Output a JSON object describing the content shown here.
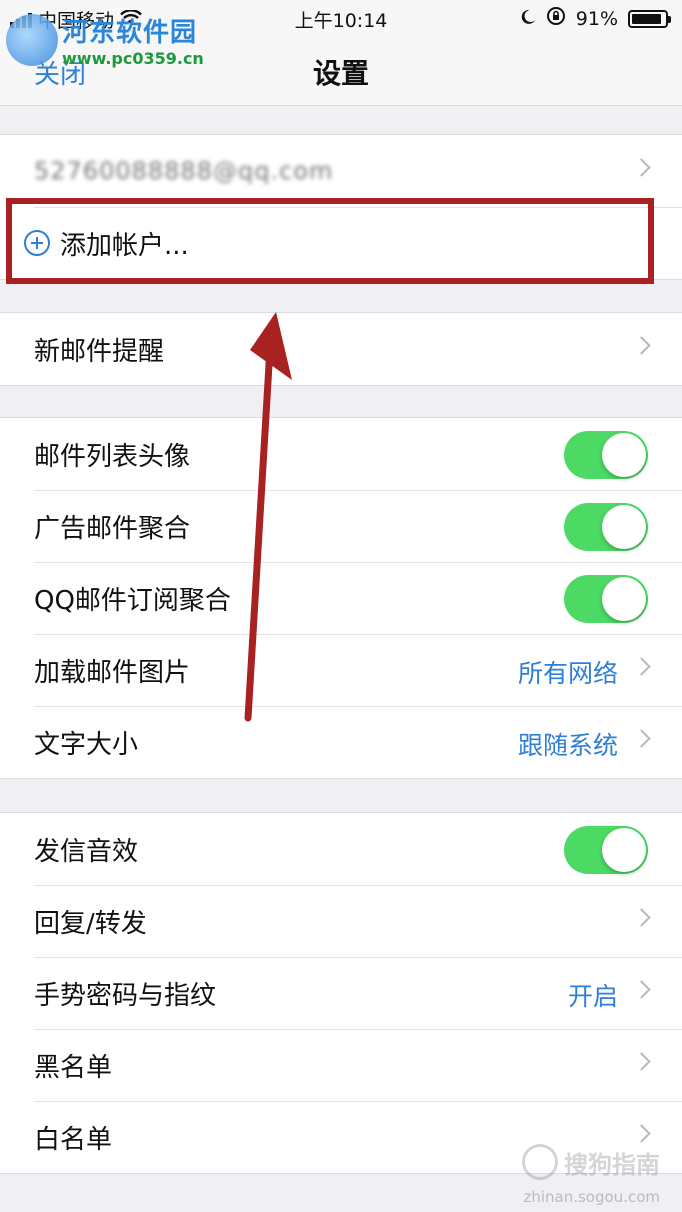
{
  "status_bar": {
    "carrier": "中国移动",
    "time": "上午10:14",
    "battery": "91%",
    "battery_level": 0.91
  },
  "watermark": {
    "title": "河东软件园",
    "url": "www.pc0359.cn"
  },
  "nav": {
    "close_label": "关闭",
    "title": "设置"
  },
  "account": {
    "email": "52760088888@qq.com",
    "add_label": "添加帐户..."
  },
  "notify": {
    "label": "新邮件提醒"
  },
  "display": {
    "avatar_label": "邮件列表头像",
    "ad_label": "广告邮件聚合",
    "qq_sub_label": "QQ邮件订阅聚合",
    "load_images_label": "加载邮件图片",
    "load_images_value": "所有网络",
    "font_size_label": "文字大小",
    "font_size_value": "跟随系统"
  },
  "misc": {
    "send_sound_label": "发信音效",
    "reply_label": "回复/转发",
    "gesture_label": "手势密码与指纹",
    "gesture_value": "开启",
    "blacklist_label": "黑名单",
    "whitelist_label": "白名单"
  },
  "sogou": {
    "name": "搜狗指南",
    "url": "zhinan.sogou.com"
  },
  "colors": {
    "accent": "#2f7fd6",
    "toggle_on": "#4cd964",
    "highlight": "#a82222"
  }
}
